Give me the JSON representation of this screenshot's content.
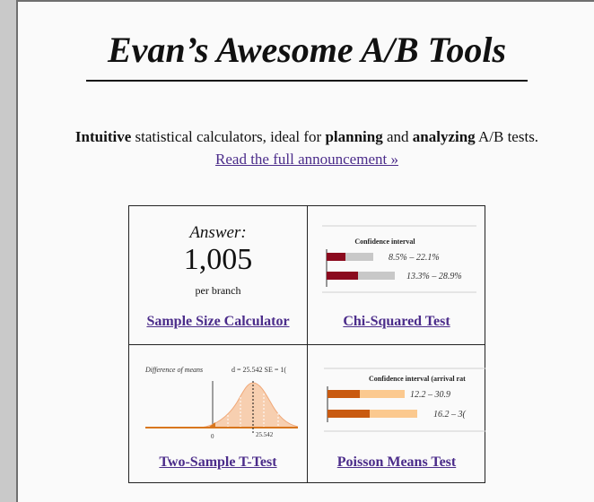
{
  "header": {
    "title": "Evan’s Awesome A/B Tools"
  },
  "intro": {
    "word1": "Intuitive",
    "text1": " statistical calculators, ideal for ",
    "word2": "planning",
    "text2": " and ",
    "word3": "analyzing",
    "text3": " A/B tests.",
    "link": "Read the full announcement »"
  },
  "tools": {
    "sample_size": {
      "answer_label": "Answer:",
      "answer_value": "1,005",
      "answer_unit": "per branch",
      "link": "Sample Size Calculator"
    },
    "chi_squared": {
      "preview_title": "Confidence interval",
      "rows": [
        {
          "label": "8.5% – 22.1%",
          "start": 0.085,
          "end": 0.221
        },
        {
          "label": "13.3% – 28.9%",
          "start": 0.133,
          "end": 0.289
        }
      ],
      "link": "Chi-Squared Test"
    },
    "t_test": {
      "preview_label": "Difference of means",
      "stats": "d = 25.542   SE = 1(",
      "zero_label": "0",
      "marker_label": "25.542",
      "link": "Two-Sample T-Test"
    },
    "poisson": {
      "preview_title": "Confidence interval (arrival rat",
      "rows": [
        {
          "label": "12.2 – 30.9"
        },
        {
          "label": "16.2 – 3("
        }
      ],
      "link": "Poisson Means Test"
    }
  },
  "colors": {
    "link": "#4b2c8a",
    "chi_bar": "#8b0a1e",
    "chi_track": "#c8c8c8",
    "poisson_bar": "#c95a10",
    "poisson_track": "#fbc98f",
    "ttest_fill": "#f7cfb0",
    "ttest_edge": "#d8761d"
  }
}
